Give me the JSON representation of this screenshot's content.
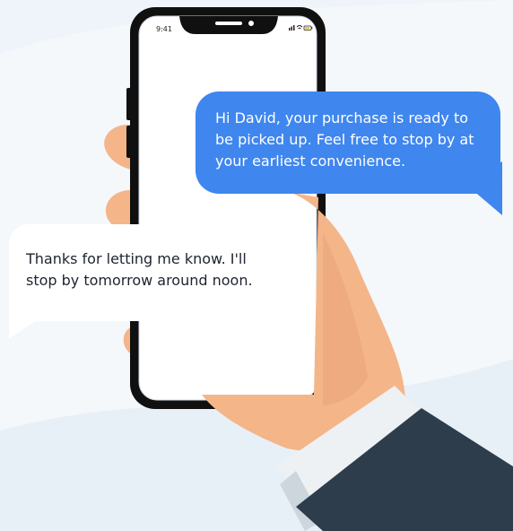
{
  "status_bar": {
    "time": "9:41",
    "icons": [
      "signal-icon",
      "wifi-icon",
      "battery-icon"
    ]
  },
  "messages": [
    {
      "direction": "outgoing",
      "text": "Hi David, your purchase is ready to\nbe picked up. Feel free to stop by at\nyour earliest convenience."
    },
    {
      "direction": "incoming",
      "text": "Thanks for letting me know. I'll\nstop by tomorrow around noon."
    }
  ],
  "colors": {
    "background": "#eef4f9",
    "outgoing_bubble": "#3f86ef",
    "incoming_bubble": "#ffffff",
    "skin": "#f4b589",
    "jacket": "#2d3d4c",
    "shirt_cuff": "#eef1f4",
    "phone_frame": "#101010"
  }
}
